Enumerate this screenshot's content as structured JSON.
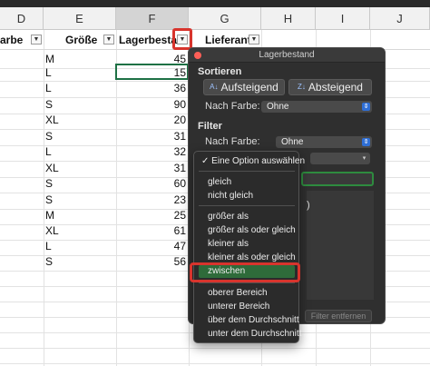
{
  "columns": [
    {
      "letter": "D",
      "selected": false
    },
    {
      "letter": "E",
      "selected": false
    },
    {
      "letter": "F",
      "selected": true
    },
    {
      "letter": "G",
      "selected": false
    },
    {
      "letter": "H",
      "selected": false
    },
    {
      "letter": "I",
      "selected": false
    },
    {
      "letter": "J",
      "selected": false
    }
  ],
  "headers": {
    "color": "arbe",
    "size": "Größe",
    "stock": "Lagerbestan",
    "supplier": "Lieferant"
  },
  "rows": [
    {
      "size": "M",
      "stock": "45"
    },
    {
      "size": "L",
      "stock": "15"
    },
    {
      "size": "L",
      "stock": "36"
    },
    {
      "size": "S",
      "stock": "90"
    },
    {
      "size": "XL",
      "stock": "20"
    },
    {
      "size": "S",
      "stock": "31"
    },
    {
      "size": "L",
      "stock": "32"
    },
    {
      "size": "XL",
      "stock": "31"
    },
    {
      "size": "S",
      "stock": "60"
    },
    {
      "size": "S",
      "stock": "23"
    },
    {
      "size": "M",
      "stock": "25"
    },
    {
      "size": "XL",
      "stock": "61"
    },
    {
      "size": "L",
      "stock": "47"
    },
    {
      "size": "S",
      "stock": "56"
    }
  ],
  "panel": {
    "title": "Lagerbestand",
    "sort_label": "Sortieren",
    "asc": "Aufsteigend",
    "desc": "Absteigend",
    "by_color_label": "Nach Farbe:",
    "sort_color_value": "Ohne",
    "filter_label": "Filter",
    "filter_color_label": "Nach Farbe:",
    "filter_color_value": "Ohne",
    "partial_text": ")",
    "clear_filter": "Filter entfernen"
  },
  "menu": {
    "items": [
      "Eine Option auswählen",
      "gleich",
      "nicht gleich",
      "größer als",
      "größer als oder gleich",
      "kleiner als",
      "kleiner als oder gleich",
      "zwischen",
      "oberer Bereich",
      "unterer Bereich",
      "über dem Durchschnitt",
      "unter dem Durchschnitt"
    ],
    "checked_index": 0,
    "highlighted_index": 7
  },
  "colors": {
    "accent_red": "#d8342d",
    "highlight_green": "#2e6b3a",
    "active_cell": "#1e7145"
  },
  "icons": {
    "filter_dropdown": "dropdown-arrow-icon",
    "sort_ascending": "sort-ascending-icon",
    "sort_descending": "sort-descending-icon",
    "checkmark": "checkmark-icon"
  }
}
